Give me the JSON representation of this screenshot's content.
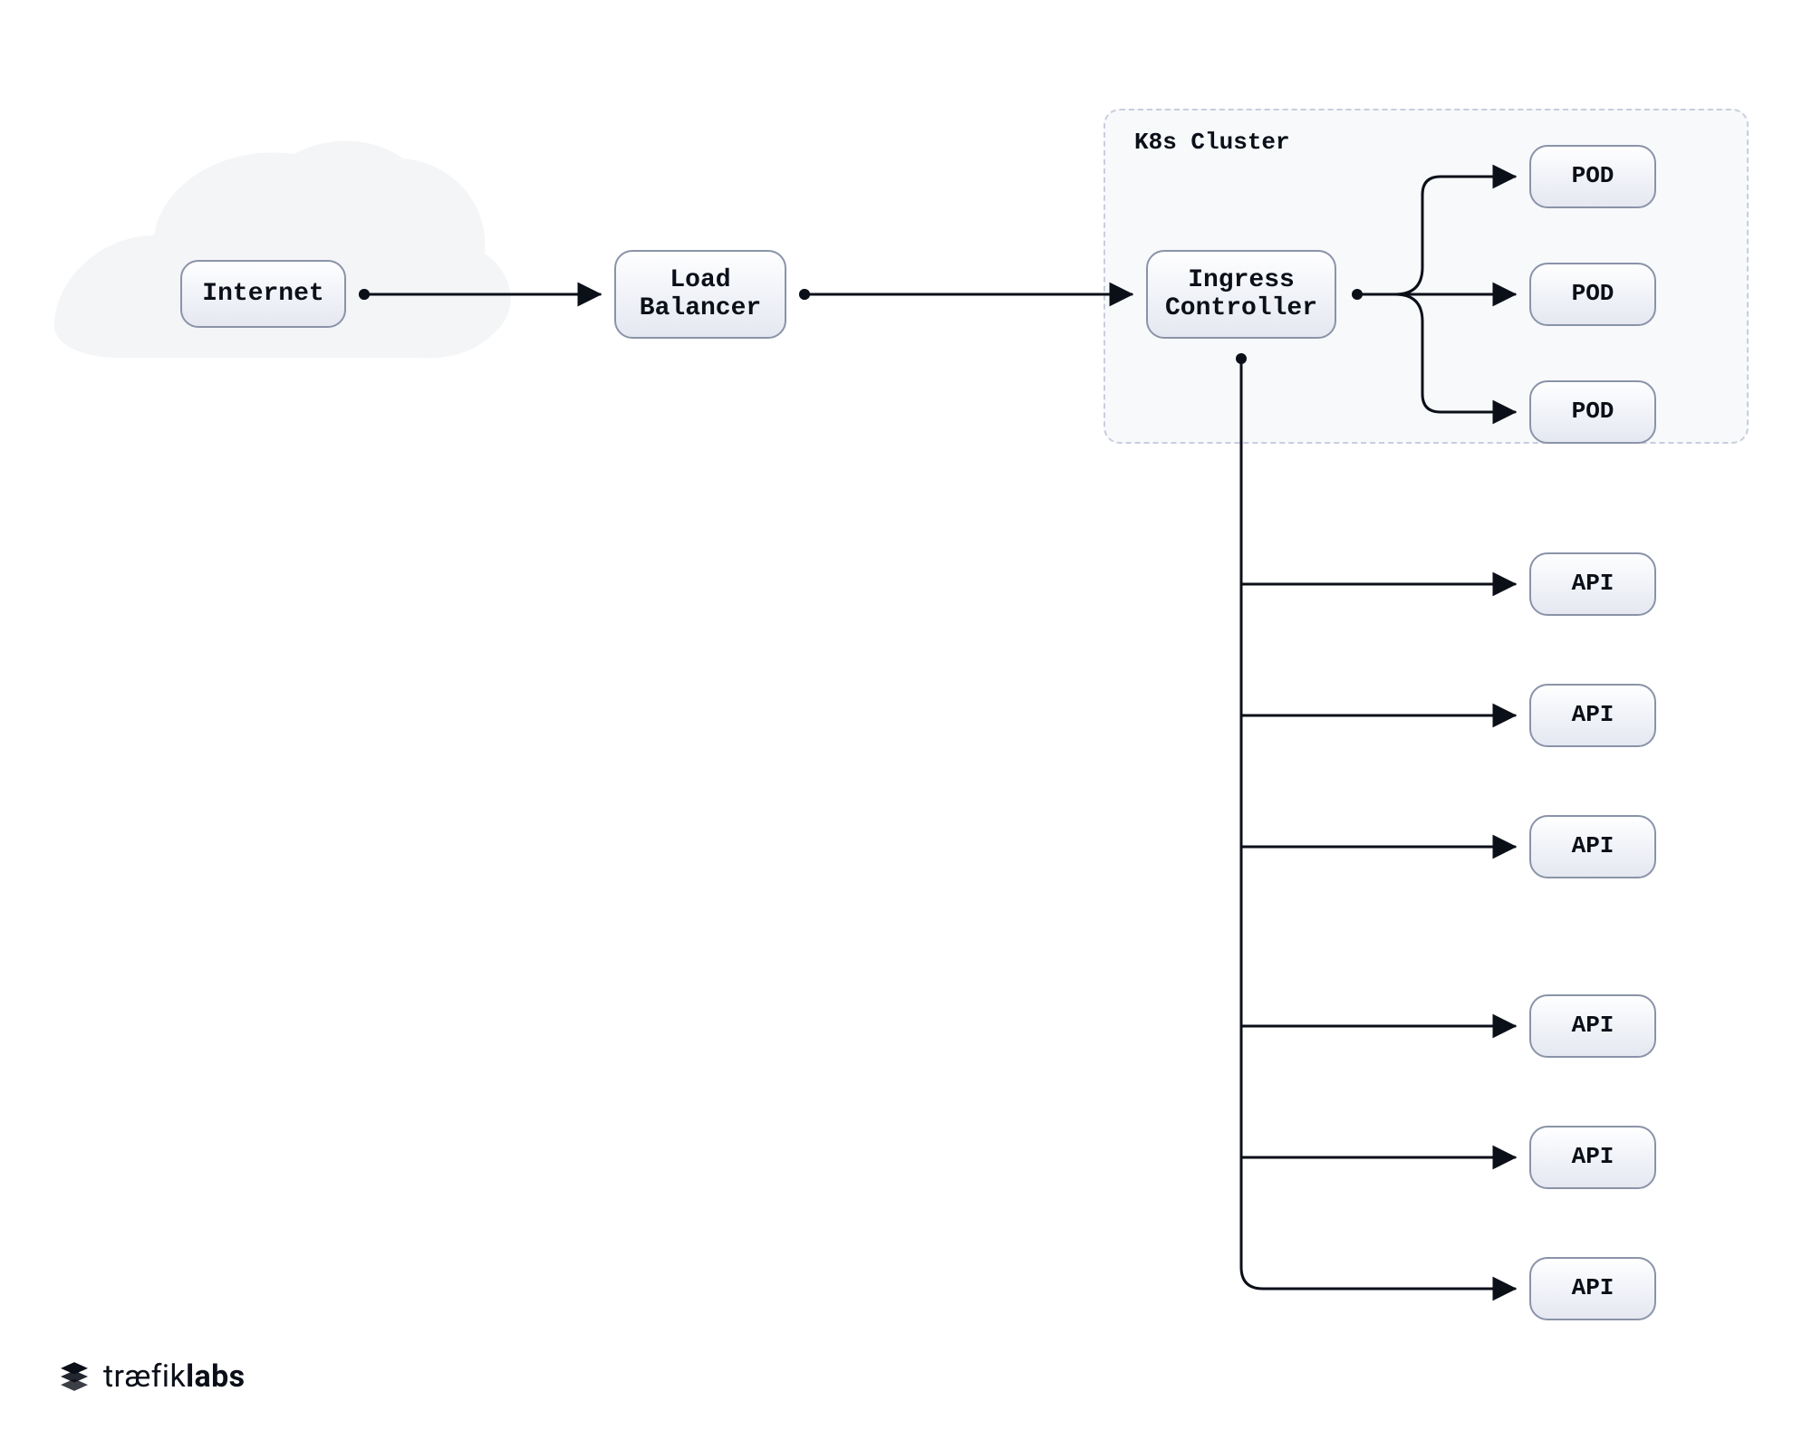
{
  "cluster": {
    "title": "K8s Cluster"
  },
  "nodes": {
    "internet": {
      "label": "Internet"
    },
    "lb": {
      "label": "Load\nBalancer"
    },
    "ingress": {
      "label": "Ingress\nController"
    },
    "pod1": {
      "label": "POD"
    },
    "pod2": {
      "label": "POD"
    },
    "pod3": {
      "label": "POD"
    },
    "api1": {
      "label": "API"
    },
    "api2": {
      "label": "API"
    },
    "api3": {
      "label": "API"
    },
    "api4": {
      "label": "API"
    },
    "api5": {
      "label": "API"
    },
    "api6": {
      "label": "API"
    }
  },
  "brand": {
    "part1": "træfik",
    "part2": "labs"
  },
  "colors": {
    "stroke": "#0b0f18",
    "nodeBorder": "#8A93A8",
    "clusterBorder": "#C9CEDD",
    "clusterBg": "#F7F9FB",
    "cloud": "#F3F5F7"
  }
}
